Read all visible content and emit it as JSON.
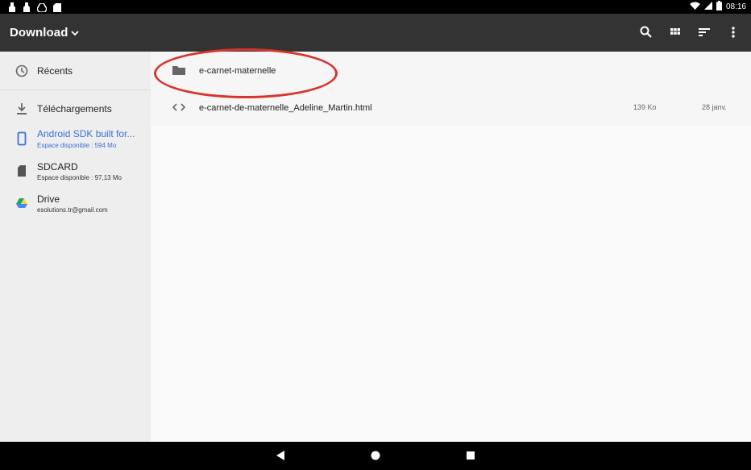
{
  "status_bar": {
    "time": "08:16",
    "icons": [
      "notification-icon",
      "notification-icon",
      "drive-icon",
      "sdcard-icon",
      "wifi-icon",
      "signal-icon",
      "battery-icon"
    ]
  },
  "toolbar": {
    "title": "Download",
    "actions": [
      "search-icon",
      "grid-view-icon",
      "sort-icon",
      "more-options-icon"
    ]
  },
  "drawer": {
    "items": [
      {
        "label": "Récents",
        "icon": "clock-icon"
      },
      {
        "label": "Téléchargements",
        "icon": "download-icon"
      },
      {
        "label": "Android SDK built for...",
        "sub": "Espace disponible : 594 Mo",
        "icon": "phone-icon",
        "selected": true
      },
      {
        "label": "SDCARD",
        "sub": "Espace disponible : 97,13 Mo",
        "icon": "sdcard-icon"
      },
      {
        "label": "Drive",
        "sub": "esolutions.tr@gmail.com",
        "icon": "drive-icon"
      }
    ]
  },
  "files": [
    {
      "name": "e-carnet-maternelle",
      "type": "folder",
      "icon": "folder-icon",
      "size": "",
      "date": ""
    },
    {
      "name": "e-carnet-de-maternelle_Adeline_Martin.html",
      "type": "file",
      "icon": "code-icon",
      "size": "139 Ko",
      "date": "28 janv."
    }
  ],
  "colors": {
    "toolbar": "#333333",
    "drawer_bg": "#eeeeee",
    "selected_text": "#3b6fd6",
    "highlight": "#d9342b"
  }
}
